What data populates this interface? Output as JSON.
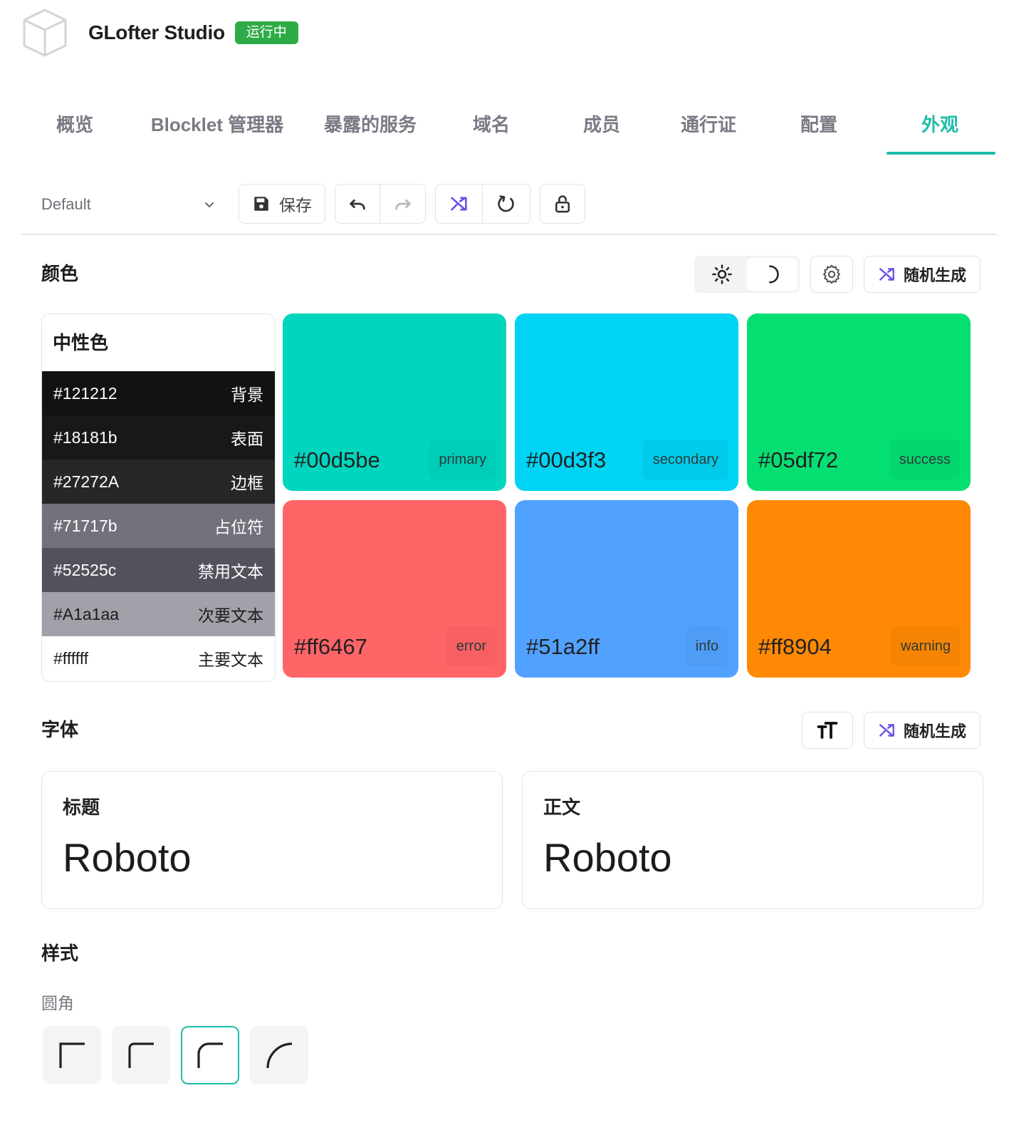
{
  "header": {
    "app_title": "GLofter Studio",
    "status": "运行中"
  },
  "tabs": [
    {
      "label": "概览"
    },
    {
      "label": "Blocklet 管理器"
    },
    {
      "label": "暴露的服务"
    },
    {
      "label": "域名"
    },
    {
      "label": "成员"
    },
    {
      "label": "通行证"
    },
    {
      "label": "配置"
    },
    {
      "label": "外观",
      "active": true
    }
  ],
  "toolbar": {
    "theme_value": "Default",
    "save_label": "保存"
  },
  "colors": {
    "title": "颜色",
    "random_label": "随机生成",
    "mode": "light",
    "neutral": {
      "title": "中性色",
      "rows": [
        {
          "hex": "#121212",
          "name": "背景",
          "bg": "#121212",
          "fg": "#ffffff"
        },
        {
          "hex": "#18181b",
          "name": "表面",
          "bg": "#18181b",
          "fg": "#ffffff"
        },
        {
          "hex": "#27272A",
          "name": "边框",
          "bg": "#27272a",
          "fg": "#ffffff"
        },
        {
          "hex": "#71717b",
          "name": "占位符",
          "bg": "#71717b",
          "fg": "#ffffff"
        },
        {
          "hex": "#52525c",
          "name": "禁用文本",
          "bg": "#52525c",
          "fg": "#ffffff"
        },
        {
          "hex": "#A1a1aa",
          "name": "次要文本",
          "bg": "#a1a1aa",
          "fg": "#1c1c1c"
        },
        {
          "hex": "#ffffff",
          "name": "主要文本",
          "bg": "#ffffff",
          "fg": "#1c1c1c"
        }
      ]
    },
    "swatches": [
      {
        "hex": "#00d5be",
        "role": "primary",
        "color": "#00d5be"
      },
      {
        "hex": "#00d3f3",
        "role": "secondary",
        "color": "#00d3f3"
      },
      {
        "hex": "#05df72",
        "role": "success",
        "color": "#05df72"
      },
      {
        "hex": "#ff6467",
        "role": "error",
        "color": "#ff6467"
      },
      {
        "hex": "#51a2ff",
        "role": "info",
        "color": "#51a2ff"
      },
      {
        "hex": "#ff8904",
        "role": "warning",
        "color": "#ff8904"
      }
    ]
  },
  "fonts": {
    "title": "字体",
    "random_label": "随机生成",
    "heading": {
      "label": "标题",
      "family": "Roboto"
    },
    "body": {
      "label": "正文",
      "family": "Roboto"
    }
  },
  "styles": {
    "title": "样式",
    "radius_label": "圆角",
    "radius_options": [
      "none",
      "small",
      "medium",
      "large"
    ],
    "selected_radius": "medium"
  },
  "accent_color": "#1dbda8",
  "status_color": "#2eab46",
  "random_icon_color": "#6b4ee6"
}
